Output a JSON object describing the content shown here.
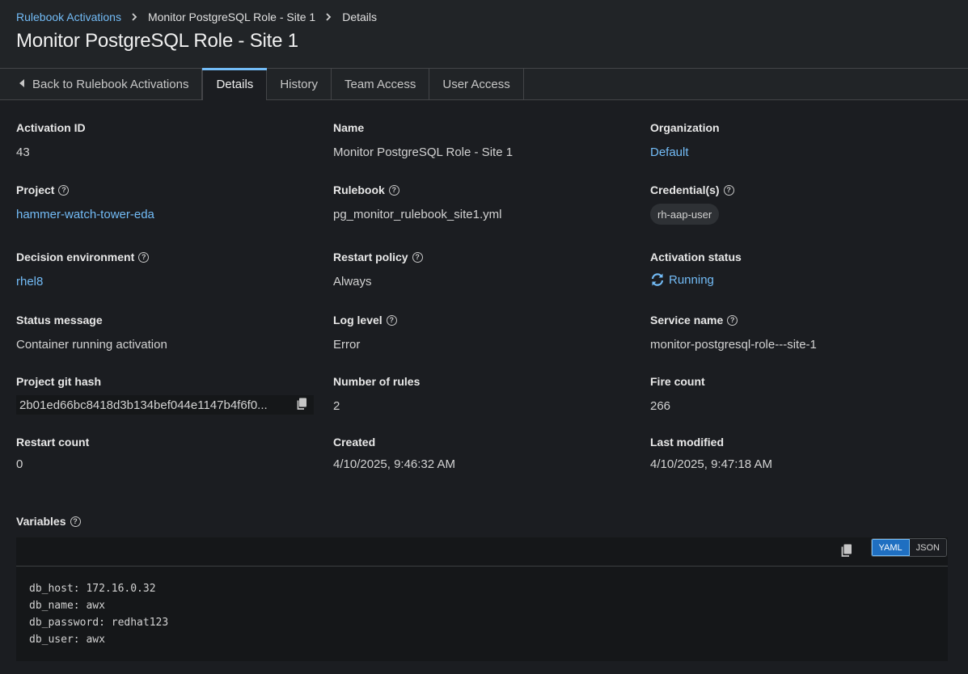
{
  "breadcrumb": {
    "root": "Rulebook Activations",
    "middle": "Monitor PostgreSQL Role - Site 1",
    "current": "Details"
  },
  "page_title": "Monitor PostgreSQL Role - Site 1",
  "tabs": {
    "back": "Back to Rulebook Activations",
    "details": "Details",
    "history": "History",
    "team_access": "Team Access",
    "user_access": "User Access"
  },
  "fields": {
    "activation_id": {
      "label": "Activation ID",
      "value": "43"
    },
    "name": {
      "label": "Name",
      "value": "Monitor PostgreSQL Role - Site 1"
    },
    "organization": {
      "label": "Organization",
      "value": "Default"
    },
    "project": {
      "label": "Project",
      "value": "hammer-watch-tower-eda"
    },
    "rulebook": {
      "label": "Rulebook",
      "value": "pg_monitor_rulebook_site1.yml"
    },
    "credentials": {
      "label": "Credential(s)",
      "value": "rh-aap-user"
    },
    "decision_environment": {
      "label": "Decision environment",
      "value": "rhel8"
    },
    "restart_policy": {
      "label": "Restart policy",
      "value": "Always"
    },
    "activation_status": {
      "label": "Activation status",
      "value": "Running"
    },
    "status_message": {
      "label": "Status message",
      "value": "Container running activation"
    },
    "log_level": {
      "label": "Log level",
      "value": "Error"
    },
    "service_name": {
      "label": "Service name",
      "value": "monitor-postgresql-role---site-1"
    },
    "project_git_hash": {
      "label": "Project git hash",
      "value": "2b01ed66bc8418d3b134bef044e1147b4f6f0..."
    },
    "number_of_rules": {
      "label": "Number of rules",
      "value": "2"
    },
    "fire_count": {
      "label": "Fire count",
      "value": "266"
    },
    "restart_count": {
      "label": "Restart count",
      "value": "0"
    },
    "created": {
      "label": "Created",
      "value": "4/10/2025, 9:46:32 AM"
    },
    "last_modified": {
      "label": "Last modified",
      "value": "4/10/2025, 9:47:18 AM"
    }
  },
  "variables": {
    "label": "Variables",
    "format_yaml": "YAML",
    "format_json": "JSON",
    "selected_format": "YAML",
    "lines": [
      "db_host: 172.16.0.32",
      "db_name: awx",
      "db_password: redhat123",
      "db_user: awx"
    ]
  },
  "colors": {
    "background": "#1b1d21",
    "header": "#212427",
    "link": "#73bcf7",
    "active_toggle": "#1f6fc1"
  },
  "icons": {
    "help": "question-circle-icon",
    "copy": "copy-icon",
    "status": "sync-icon",
    "breadcrumb_separator": "chevron-right-icon",
    "back": "caret-left-icon"
  }
}
